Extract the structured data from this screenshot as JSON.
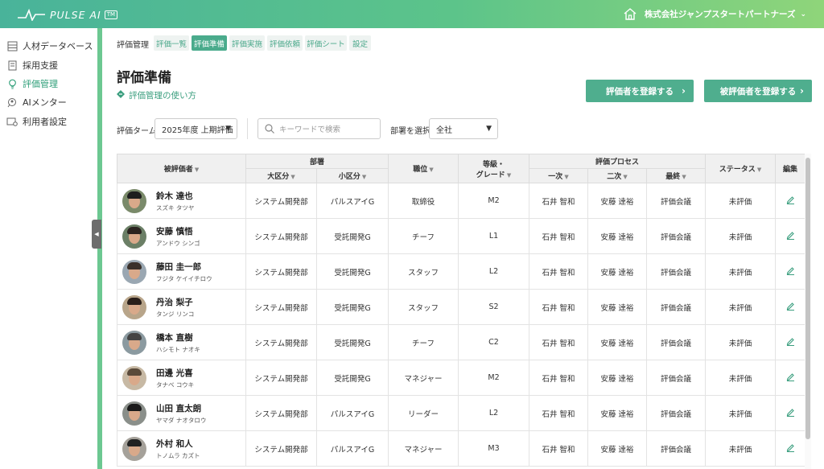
{
  "header": {
    "logo_text": "PULSE AI",
    "logo_badge": "TM",
    "company": "株式会社ジャンプスタートパートナーズ"
  },
  "sidebar": {
    "items": [
      {
        "label": "人材データベース",
        "icon": "database-icon"
      },
      {
        "label": "採用支援",
        "icon": "document-icon"
      },
      {
        "label": "評価管理",
        "icon": "lightbulb-icon",
        "active": true
      },
      {
        "label": "AIメンター",
        "icon": "mentor-icon"
      },
      {
        "label": "利用者設定",
        "icon": "user-settings-icon"
      }
    ]
  },
  "tabs": {
    "label": "評価管理",
    "items": [
      "評価一覧",
      "評価準備",
      "評価実施",
      "評価依頼",
      "評価シート",
      "設定"
    ],
    "active_index": 1
  },
  "page": {
    "title": "評価準備",
    "howto": "評価管理の使い方",
    "register_evaluator": "評価者を登録する",
    "register_evaluatee": "被評価者を登録する"
  },
  "filters": {
    "term_label": "評価ターム",
    "term_value": "2025年度 上期評価",
    "search_placeholder": "キーワードで検索",
    "dept_label": "部署を選択",
    "dept_value": "全社"
  },
  "table": {
    "headers": {
      "evaluatee": "被評価者",
      "dept": "部署",
      "dept_major": "大区分",
      "dept_minor": "小区分",
      "position": "職位",
      "grade": "等級・\nグレード",
      "process": "評価プロセス",
      "first": "一次",
      "second": "二次",
      "final": "最終",
      "status": "ステータス",
      "edit": "編集"
    },
    "rows": [
      {
        "name": "鈴木 達也",
        "kana": "スズキ タツヤ",
        "major": "システム開発部",
        "minor": "パルスアイG",
        "position": "取締役",
        "grade": "M2",
        "first": "石井 智和",
        "second": "安藤 達裕",
        "final": "評価会議",
        "status": "未評価"
      },
      {
        "name": "安藤 慎悟",
        "kana": "アンドウ シンゴ",
        "major": "システム開発部",
        "minor": "受託開発G",
        "position": "チーフ",
        "grade": "L1",
        "first": "石井 智和",
        "second": "安藤 達裕",
        "final": "評価会議",
        "status": "未評価"
      },
      {
        "name": "藤田 圭一郎",
        "kana": "フジタ ケイイチロウ",
        "major": "システム開発部",
        "minor": "受託開発G",
        "position": "スタッフ",
        "grade": "L2",
        "first": "石井 智和",
        "second": "安藤 達裕",
        "final": "評価会議",
        "status": "未評価"
      },
      {
        "name": "丹治 梨子",
        "kana": "タンジ リンコ",
        "major": "システム開発部",
        "minor": "受託開発G",
        "position": "スタッフ",
        "grade": "S2",
        "first": "石井 智和",
        "second": "安藤 達裕",
        "final": "評価会議",
        "status": "未評価"
      },
      {
        "name": "橋本 直樹",
        "kana": "ハシモト ナオキ",
        "major": "システム開発部",
        "minor": "受託開発G",
        "position": "チーフ",
        "grade": "C2",
        "first": "石井 智和",
        "second": "安藤 達裕",
        "final": "評価会議",
        "status": "未評価"
      },
      {
        "name": "田邊 光喜",
        "kana": "タナベ コウキ",
        "major": "システム開発部",
        "minor": "受託開発G",
        "position": "マネジャー",
        "grade": "M2",
        "first": "石井 智和",
        "second": "安藤 達裕",
        "final": "評価会議",
        "status": "未評価"
      },
      {
        "name": "山田 直太朗",
        "kana": "ヤマダ ナオタロウ",
        "major": "システム開発部",
        "minor": "パルスアイG",
        "position": "リーダー",
        "grade": "L2",
        "first": "石井 智和",
        "second": "安藤 達裕",
        "final": "評価会議",
        "status": "未評価"
      },
      {
        "name": "外村 和人",
        "kana": "トノムラ カズト",
        "major": "システム開発部",
        "minor": "パルスアイG",
        "position": "マネジャー",
        "grade": "M3",
        "first": "石井 智和",
        "second": "安藤 達裕",
        "final": "評価会議",
        "status": "未評価"
      }
    ]
  },
  "colors": {
    "accent": "#4fae8e",
    "header_start": "#49b39a",
    "header_end": "#8fd57a"
  }
}
